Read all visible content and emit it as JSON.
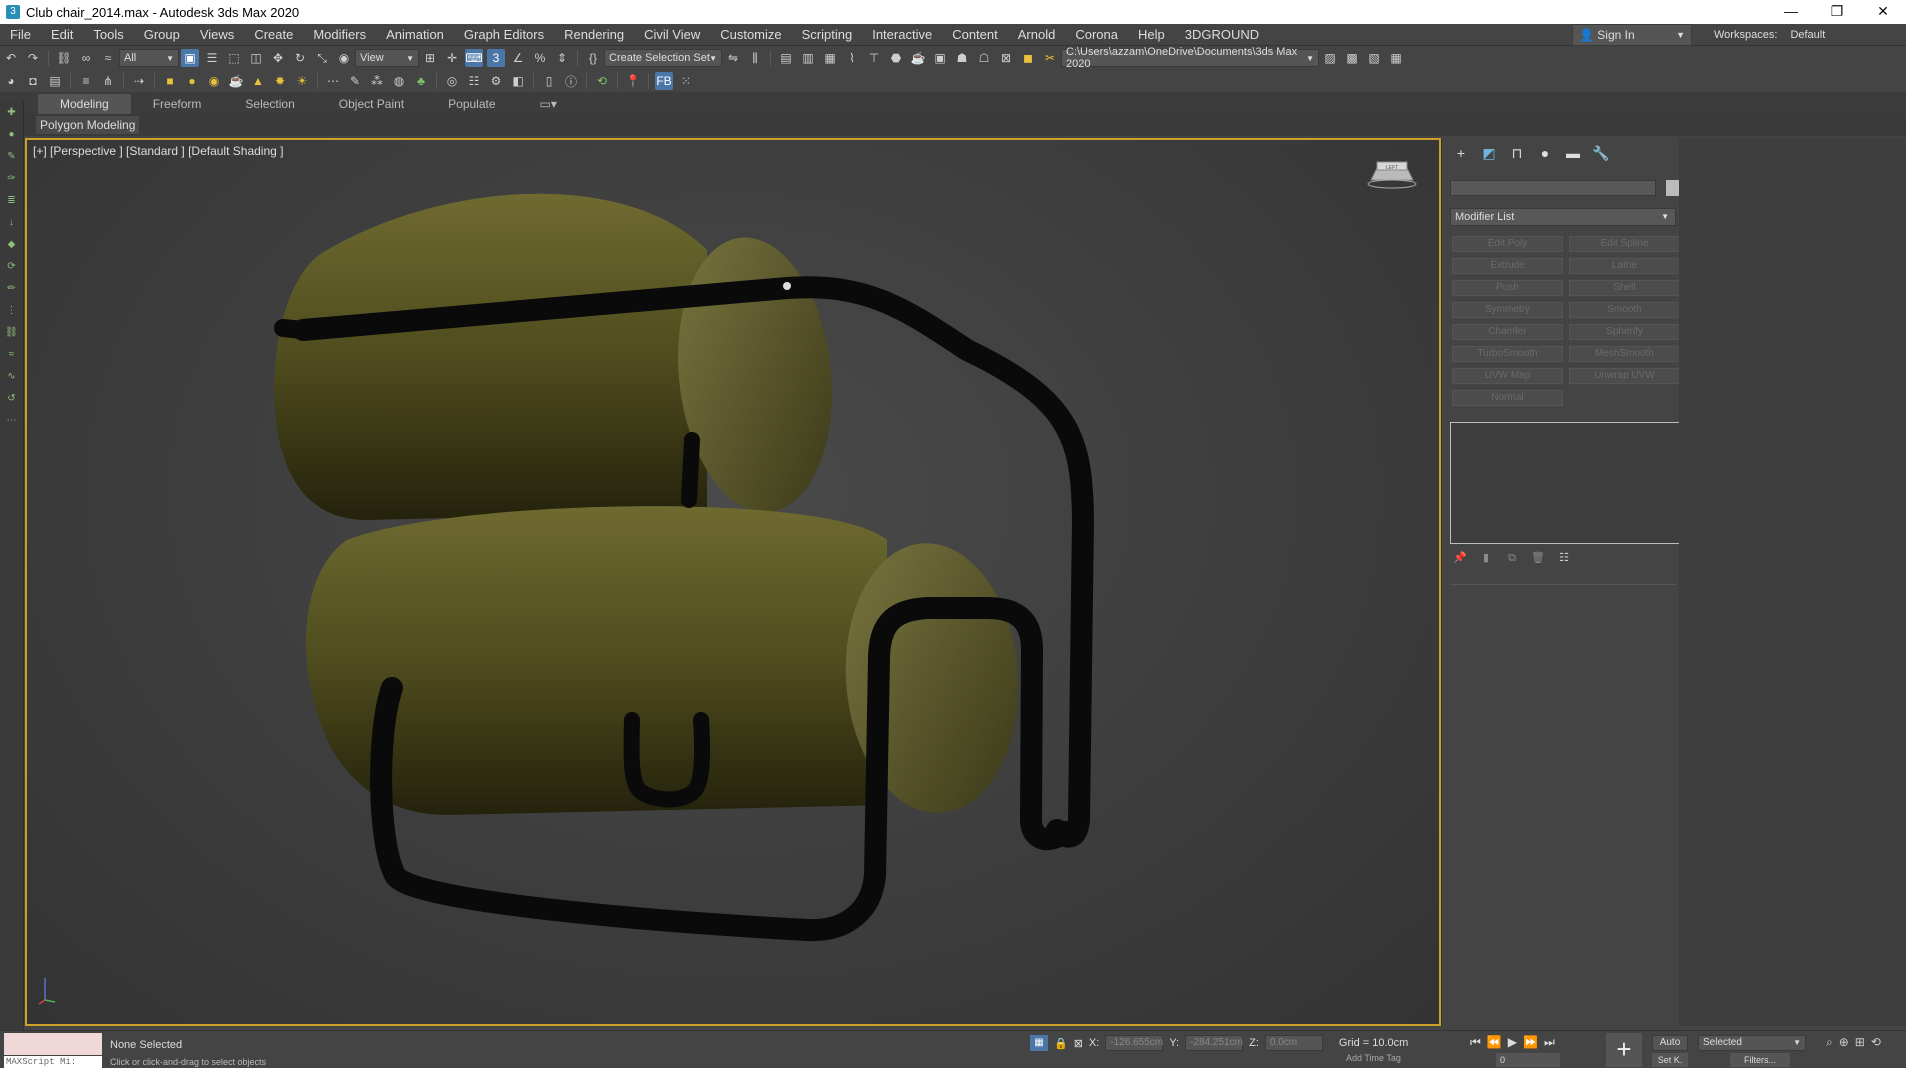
{
  "window": {
    "title": "Club chair_2014.max - Autodesk 3ds Max 2020",
    "minimize": "—",
    "restore": "❐",
    "close": "✕"
  },
  "menu": [
    "File",
    "Edit",
    "Tools",
    "Group",
    "Views",
    "Create",
    "Modifiers",
    "Animation",
    "Graph Editors",
    "Rendering",
    "Civil View",
    "Customize",
    "Scripting",
    "Interactive",
    "Content",
    "Arnold",
    "Corona",
    "Help",
    "3DGROUND"
  ],
  "account": {
    "signin": "Sign In",
    "workspaces_label": "Workspaces:",
    "workspace": "Default"
  },
  "toolbar": {
    "filter_value": "All",
    "ref_coord": "View",
    "selection_set": "Create Selection Set",
    "project_path": "C:\\Users\\azzam\\OneDrive\\Documents\\3ds Max 2020"
  },
  "ribbon": {
    "tabs": [
      "Modeling",
      "Freeform",
      "Selection",
      "Object Paint",
      "Populate"
    ],
    "active": "Modeling",
    "subpanel": "Polygon Modeling"
  },
  "viewport": {
    "label": "[+] [Perspective ] [Standard ] [Default Shading ]",
    "cube_label": "LEFT"
  },
  "command_panel": {
    "modifier_list": "Modifier List",
    "buttons": [
      "Edit Poly",
      "Edit Spline",
      "Extrude",
      "Lathe",
      "Push",
      "Shell",
      "Symmetry",
      "Smooth",
      "Chamfer",
      "Spherify",
      "TurboSmooth",
      "MeshSmooth",
      "UVW Map",
      "Unwrap UVW",
      "Normal"
    ]
  },
  "status": {
    "maxscript": "MAXScript Mi:",
    "selection": "None Selected",
    "prompt": "Click or click-and-drag to select objects",
    "x_label": "X:",
    "x_value": "-126.655cm",
    "y_label": "Y:",
    "y_value": "-284.251cm",
    "z_label": "Z:",
    "z_value": "0.0cm",
    "grid": "Grid = 10.0cm",
    "add_time_tag": "Add Time Tag",
    "auto": "Auto",
    "set_key": "Set K.",
    "key_filter": "Selected",
    "filters": "Filters...",
    "frame": "0"
  },
  "colors": {
    "accent": "#4a76a8",
    "viewport_border": "#c9a227",
    "cushion": "#5a5a22",
    "frame": "#0a0a0a"
  }
}
